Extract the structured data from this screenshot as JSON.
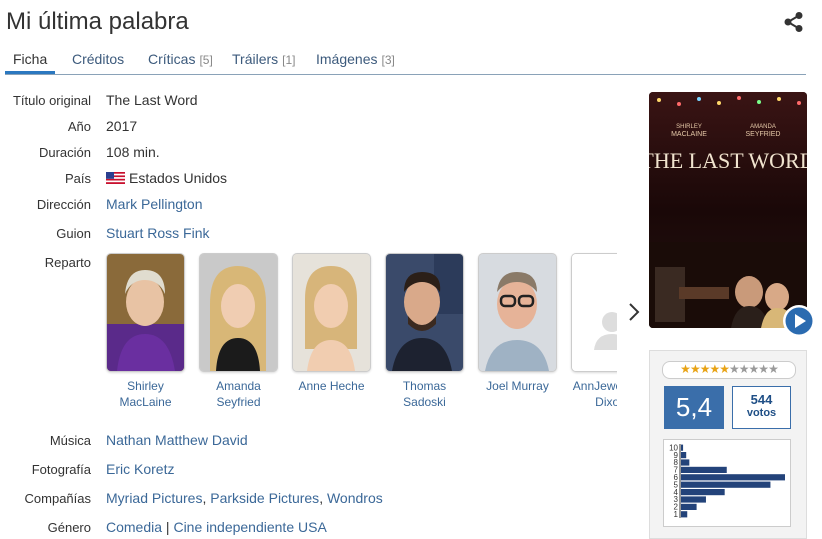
{
  "title": "Mi última palabra",
  "tabs": [
    {
      "label": "Ficha",
      "count": ""
    },
    {
      "label": "Créditos",
      "count": ""
    },
    {
      "label": "Críticas",
      "count": "[5]"
    },
    {
      "label": "Tráilers",
      "count": "[1]"
    },
    {
      "label": "Imágenes",
      "count": "[3]"
    }
  ],
  "info": {
    "original_title_label": "Título original",
    "original_title": "The Last Word",
    "year_label": "Año",
    "year": "2017",
    "duration_label": "Duración",
    "duration": "108 min.",
    "country_label": "País",
    "country": "Estados Unidos",
    "director_label": "Dirección",
    "director": "Mark Pellington",
    "script_label": "Guion",
    "script": "Stuart Ross Fink",
    "cast_label": "Reparto",
    "music_label": "Música",
    "music": "Nathan Matthew David",
    "photo_label": "Fotografía",
    "photo": "Eric Koretz",
    "companies_label": "Compañías",
    "companies": [
      "Myriad Pictures",
      "Parkside Pictures",
      "Wondros"
    ],
    "genre_label": "Género",
    "genre": [
      "Comedia",
      "Cine independiente USA"
    ]
  },
  "cast": [
    {
      "line1": "Shirley",
      "line2": "MacLaine"
    },
    {
      "line1": "Amanda",
      "line2": "Seyfried"
    },
    {
      "line1": "Anne Heche",
      "line2": ""
    },
    {
      "line1": "Thomas",
      "line2": "Sadoski"
    },
    {
      "line1": "Joel Murray",
      "line2": ""
    },
    {
      "line1": "AnnJewel Lee",
      "line2": "Dixon"
    }
  ],
  "poster": {
    "actor1_line1": "SHIRLEY",
    "actor1_line2": "MACLAINE",
    "actor2_line1": "AMANDA",
    "actor2_line2": "SEYFRIED",
    "title": "THE LAST WORD"
  },
  "rating": {
    "average": "5,4",
    "votes": "544",
    "votes_label": "votos",
    "stars_filled": 5.4,
    "stars_total": 10,
    "histogram": {
      "labels": [
        "10",
        "9",
        "8",
        "7",
        "6",
        "5",
        "4",
        "3",
        "2",
        "1"
      ],
      "values": [
        0.02,
        0.05,
        0.08,
        0.44,
        1.0,
        0.86,
        0.42,
        0.24,
        0.15,
        0.06
      ]
    }
  },
  "colors": {
    "link": "#3b6898",
    "accent": "#2b78c0",
    "score_bg": "#3a6eaa"
  }
}
